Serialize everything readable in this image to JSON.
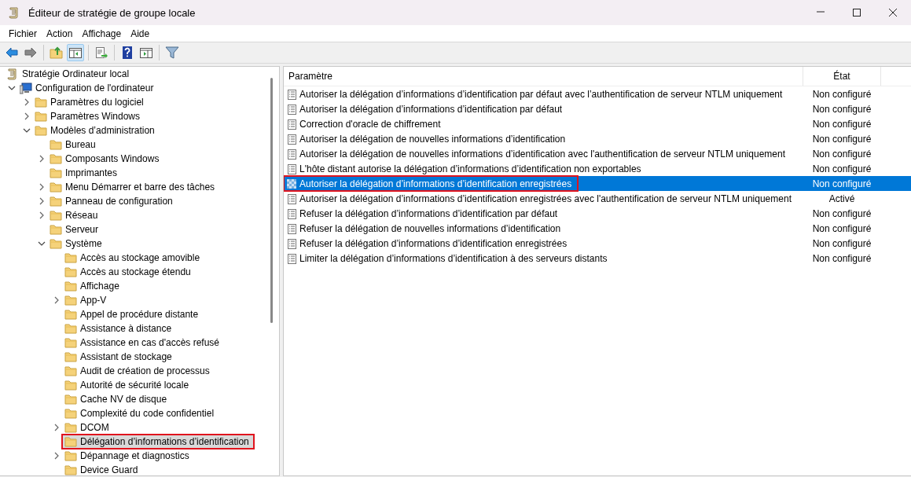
{
  "window": {
    "title": "Éditeur de stratégie de groupe locale"
  },
  "menu": [
    "Fichier",
    "Action",
    "Affichage",
    "Aide"
  ],
  "toolbar": [
    [
      {
        "kind": "back",
        "pressed": false
      },
      {
        "kind": "forward",
        "pressed": false
      }
    ],
    [
      {
        "kind": "up",
        "pressed": false
      },
      {
        "kind": "tree",
        "pressed": true
      }
    ],
    [
      {
        "kind": "export",
        "pressed": false
      }
    ],
    [
      {
        "kind": "help",
        "pressed": false
      },
      {
        "kind": "pane",
        "pressed": false
      }
    ],
    [
      {
        "kind": "filter",
        "pressed": false
      }
    ]
  ],
  "tree": [
    {
      "label": "Stratégie Ordinateur local",
      "kind": "scroll",
      "expandable": false,
      "selected": false,
      "annotated": false,
      "children": [
        {
          "label": "Configuration de l'ordinateur",
          "kind": "computer",
          "expandable": true,
          "expanded": true,
          "selected": false,
          "annotated": false,
          "children": [
            {
              "label": "Paramètres du logiciel",
              "kind": "folder",
              "expandable": true,
              "expanded": false,
              "selected": false,
              "annotated": false
            },
            {
              "label": "Paramètres Windows",
              "kind": "folder",
              "expandable": true,
              "expanded": false,
              "selected": false,
              "annotated": false
            },
            {
              "label": "Modèles d’administration",
              "kind": "folder",
              "expandable": true,
              "expanded": true,
              "selected": false,
              "annotated": false,
              "children": [
                {
                  "label": "Bureau",
                  "kind": "folder",
                  "expandable": false,
                  "selected": false,
                  "annotated": false
                },
                {
                  "label": "Composants Windows",
                  "kind": "folder",
                  "expandable": true,
                  "expanded": false,
                  "selected": false,
                  "annotated": false
                },
                {
                  "label": "Imprimantes",
                  "kind": "folder",
                  "expandable": false,
                  "selected": false,
                  "annotated": false
                },
                {
                  "label": "Menu Démarrer et barre des tâches",
                  "kind": "folder",
                  "expandable": true,
                  "expanded": false,
                  "selected": false,
                  "annotated": false
                },
                {
                  "label": "Panneau de configuration",
                  "kind": "folder",
                  "expandable": true,
                  "expanded": false,
                  "selected": false,
                  "annotated": false
                },
                {
                  "label": "Réseau",
                  "kind": "folder",
                  "expandable": true,
                  "expanded": false,
                  "selected": false,
                  "annotated": false
                },
                {
                  "label": "Serveur",
                  "kind": "folder",
                  "expandable": false,
                  "selected": false,
                  "annotated": false
                },
                {
                  "label": "Système",
                  "kind": "folder",
                  "expandable": true,
                  "expanded": true,
                  "selected": false,
                  "annotated": false,
                  "children": [
                    {
                      "label": "Accès au stockage amovible",
                      "kind": "folder",
                      "expandable": false,
                      "selected": false,
                      "annotated": false
                    },
                    {
                      "label": "Accès au stockage étendu",
                      "kind": "folder",
                      "expandable": false,
                      "selected": false,
                      "annotated": false
                    },
                    {
                      "label": "Affichage",
                      "kind": "folder",
                      "expandable": false,
                      "selected": false,
                      "annotated": false
                    },
                    {
                      "label": "App-V",
                      "kind": "folder",
                      "expandable": true,
                      "expanded": false,
                      "selected": false,
                      "annotated": false
                    },
                    {
                      "label": "Appel de procédure distante",
                      "kind": "folder",
                      "expandable": false,
                      "selected": false,
                      "annotated": false
                    },
                    {
                      "label": "Assistance à distance",
                      "kind": "folder",
                      "expandable": false,
                      "selected": false,
                      "annotated": false
                    },
                    {
                      "label": "Assistance en cas d'accès refusé",
                      "kind": "folder",
                      "expandable": false,
                      "selected": false,
                      "annotated": false
                    },
                    {
                      "label": "Assistant de stockage",
                      "kind": "folder",
                      "expandable": false,
                      "selected": false,
                      "annotated": false
                    },
                    {
                      "label": "Audit de création de processus",
                      "kind": "folder",
                      "expandable": false,
                      "selected": false,
                      "annotated": false
                    },
                    {
                      "label": "Autorité de sécurité locale",
                      "kind": "folder",
                      "expandable": false,
                      "selected": false,
                      "annotated": false
                    },
                    {
                      "label": "Cache NV de disque",
                      "kind": "folder",
                      "expandable": false,
                      "selected": false,
                      "annotated": false
                    },
                    {
                      "label": "Complexité du code confidentiel",
                      "kind": "folder",
                      "expandable": false,
                      "selected": false,
                      "annotated": false
                    },
                    {
                      "label": "DCOM",
                      "kind": "folder",
                      "expandable": true,
                      "expanded": false,
                      "selected": false,
                      "annotated": false
                    },
                    {
                      "label": "Délégation d’informations d’identification",
                      "kind": "folder",
                      "expandable": false,
                      "selected": true,
                      "annotated": true
                    },
                    {
                      "label": "Dépannage et diagnostics",
                      "kind": "folder",
                      "expandable": true,
                      "expanded": false,
                      "selected": false,
                      "annotated": false
                    },
                    {
                      "label": "Device Guard",
                      "kind": "folder",
                      "expandable": false,
                      "selected": false,
                      "annotated": false
                    }
                  ]
                }
              ]
            }
          ]
        }
      ]
    }
  ],
  "table": {
    "columns": [
      "Paramètre",
      "État"
    ],
    "rows": [
      {
        "name": "Autoriser la délégation d’informations d’identification par défaut avec l’authentification de serveur NTLM uniquement",
        "state": "Non configuré",
        "selected": false,
        "annotated": false
      },
      {
        "name": "Autoriser la délégation d’informations d’identification par défaut",
        "state": "Non configuré",
        "selected": false,
        "annotated": false
      },
      {
        "name": "Correction d'oracle de chiffrement",
        "state": "Non configuré",
        "selected": false,
        "annotated": false
      },
      {
        "name": "Autoriser la délégation de nouvelles informations d’identification",
        "state": "Non configuré",
        "selected": false,
        "annotated": false
      },
      {
        "name": "Autoriser la délégation de nouvelles informations d’identification avec l'authentification de serveur NTLM uniquement",
        "state": "Non configuré",
        "selected": false,
        "annotated": false
      },
      {
        "name": "L'hôte distant autorise la délégation d’informations d’identification non exportables",
        "state": "Non configuré",
        "selected": false,
        "annotated": false
      },
      {
        "name": "Autoriser la délégation d’informations d’identification enregistrées",
        "state": "Non configuré",
        "selected": true,
        "annotated": true
      },
      {
        "name": "Autoriser la délégation d’informations d’identification enregistrées avec l'authentification de serveur NTLM uniquement",
        "state": "Activé",
        "selected": false,
        "annotated": false
      },
      {
        "name": "Refuser la délégation d’informations d’identification par défaut",
        "state": "Non configuré",
        "selected": false,
        "annotated": false
      },
      {
        "name": "Refuser la délégation de nouvelles informations d’identification",
        "state": "Non configuré",
        "selected": false,
        "annotated": false
      },
      {
        "name": "Refuser la délégation d’informations d’identification enregistrées",
        "state": "Non configuré",
        "selected": false,
        "annotated": false
      },
      {
        "name": "Limiter la délégation d’informations d’identification à des serveurs distants",
        "state": "Non configuré",
        "selected": false,
        "annotated": false
      }
    ]
  }
}
